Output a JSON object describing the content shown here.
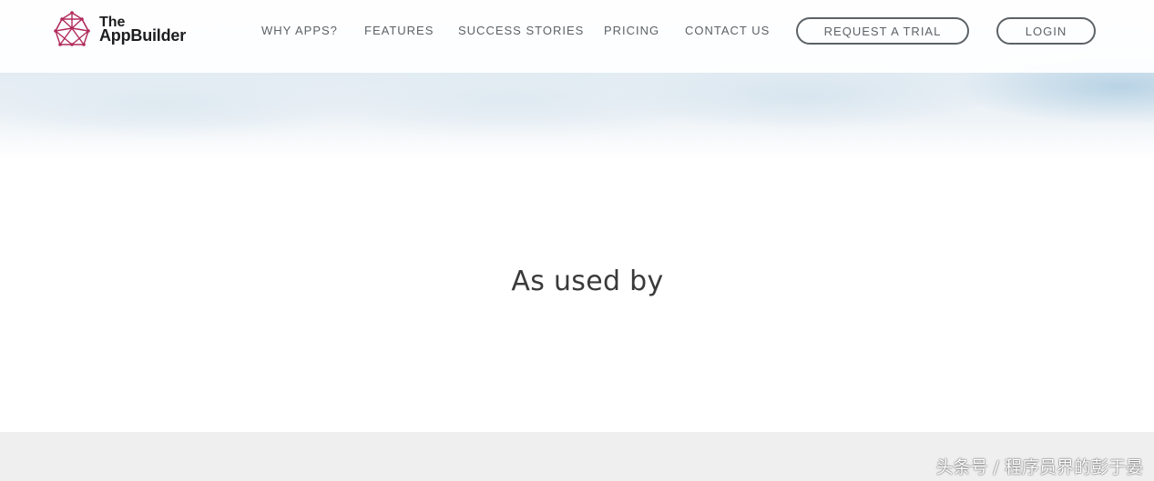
{
  "brand": {
    "line1": "The",
    "line2": "AppBuilder",
    "accent_color": "#b12a5b"
  },
  "nav": {
    "items": [
      {
        "label": "WHY APPS?"
      },
      {
        "label": "FEATURES"
      },
      {
        "label": "SUCCESS STORIES"
      },
      {
        "label": "PRICING"
      },
      {
        "label": "CONTACT US"
      }
    ],
    "trial_label": "REQUEST A TRIAL",
    "login_label": "LOGIN"
  },
  "main": {
    "title": "As used by"
  },
  "watermark": {
    "text": "头条号 / 程序员界的彭于晏"
  },
  "colors": {
    "nav_text": "#5c6266",
    "title_text": "#3a3a3a",
    "band_bg": "#efefef"
  }
}
